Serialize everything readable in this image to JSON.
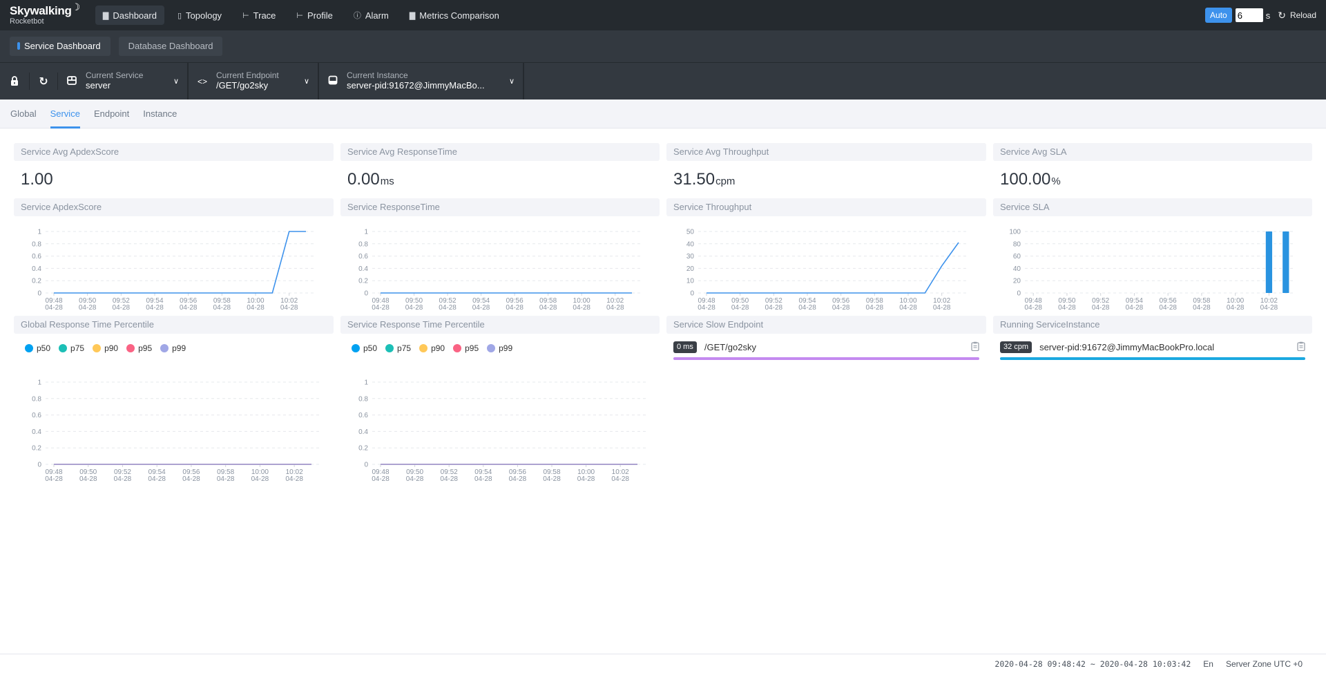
{
  "app": {
    "logo_main": "Skywalking",
    "logo_sub": "Rocketbot"
  },
  "nav": {
    "items": [
      {
        "label": "Dashboard",
        "icon": "chart-icon",
        "active": true
      },
      {
        "label": "Topology",
        "icon": "topology-icon",
        "active": false
      },
      {
        "label": "Trace",
        "icon": "trace-icon",
        "active": false
      },
      {
        "label": "Profile",
        "icon": "profile-icon",
        "active": false
      },
      {
        "label": "Alarm",
        "icon": "alarm-icon",
        "active": false
      },
      {
        "label": "Metrics Comparison",
        "icon": "chart-icon",
        "active": false
      }
    ],
    "auto_label": "Auto",
    "interval_value": "6",
    "interval_unit": "s",
    "reload_label": "Reload"
  },
  "dashboards": {
    "tabs": [
      {
        "label": "Service Dashboard",
        "active": true
      },
      {
        "label": "Database Dashboard",
        "active": false
      }
    ]
  },
  "selectors": {
    "service": {
      "label": "Current Service",
      "value": "server"
    },
    "endpoint": {
      "label": "Current Endpoint",
      "value": "/GET/go2sky"
    },
    "instance": {
      "label": "Current Instance",
      "value": "server-pid:91672@JimmyMacBo..."
    }
  },
  "view_tabs": [
    {
      "label": "Global",
      "active": false
    },
    {
      "label": "Service",
      "active": true
    },
    {
      "label": "Endpoint",
      "active": false
    },
    {
      "label": "Instance",
      "active": false
    }
  ],
  "cards": {
    "avg_apdex": {
      "title": "Service Avg ApdexScore",
      "value": "1.00",
      "unit": ""
    },
    "avg_resp": {
      "title": "Service Avg ResponseTime",
      "value": "0.00",
      "unit": "ms"
    },
    "avg_throughput": {
      "title": "Service Avg Throughput",
      "value": "31.50",
      "unit": "cpm"
    },
    "avg_sla": {
      "title": "Service Avg SLA",
      "value": "100.00",
      "unit": "%"
    },
    "apdex_chart_title": "Service ApdexScore",
    "resp_chart_title": "Service ResponseTime",
    "throughput_chart_title": "Service Throughput",
    "sla_chart_title": "Service SLA",
    "global_pct_title": "Global Response Time Percentile",
    "service_pct_title": "Service Response Time Percentile",
    "slow_endpoint": {
      "title": "Service Slow Endpoint",
      "items": [
        {
          "badge": "0 ms",
          "name": "/GET/go2sky",
          "bar_color": "#c48af0",
          "fill": 1.0
        }
      ]
    },
    "running_instance": {
      "title": "Running ServiceInstance",
      "items": [
        {
          "badge": "32 cpm",
          "name": "server-pid:91672@JimmyMacBookPro.local",
          "bar_color": "#1ba8e0",
          "fill": 1.0
        }
      ]
    }
  },
  "chart_data": [
    {
      "id": "apdex",
      "type": "line",
      "title": "Service ApdexScore",
      "x": [
        "09:48",
        "09:49",
        "09:50",
        "09:51",
        "09:52",
        "09:53",
        "09:54",
        "09:55",
        "09:56",
        "09:57",
        "09:58",
        "09:59",
        "10:00",
        "10:01",
        "10:02",
        "10:03"
      ],
      "xtick_labels": [
        [
          "09:48",
          "04-28"
        ],
        [
          "09:50",
          "04-28"
        ],
        [
          "09:52",
          "04-28"
        ],
        [
          "09:54",
          "04-28"
        ],
        [
          "09:56",
          "04-28"
        ],
        [
          "09:58",
          "04-28"
        ],
        [
          "10:00",
          "04-28"
        ],
        [
          "10:02",
          "04-28"
        ]
      ],
      "series": [
        {
          "name": "ApdexScore",
          "color": "#3d92ec",
          "values": [
            0,
            0,
            0,
            0,
            0,
            0,
            0,
            0,
            0,
            0,
            0,
            0,
            0,
            0,
            1,
            1
          ]
        }
      ],
      "ylim": [
        0,
        1
      ],
      "yticks": [
        "0",
        "0.2",
        "0.4",
        "0.6",
        "0.8",
        "1"
      ],
      "grid": true
    },
    {
      "id": "resp",
      "type": "line",
      "title": "Service ResponseTime",
      "x": [
        "09:48",
        "09:49",
        "09:50",
        "09:51",
        "09:52",
        "09:53",
        "09:54",
        "09:55",
        "09:56",
        "09:57",
        "09:58",
        "09:59",
        "10:00",
        "10:01",
        "10:02",
        "10:03"
      ],
      "xtick_labels": [
        [
          "09:48",
          "04-28"
        ],
        [
          "09:50",
          "04-28"
        ],
        [
          "09:52",
          "04-28"
        ],
        [
          "09:54",
          "04-28"
        ],
        [
          "09:56",
          "04-28"
        ],
        [
          "09:58",
          "04-28"
        ],
        [
          "10:00",
          "04-28"
        ],
        [
          "10:02",
          "04-28"
        ]
      ],
      "series": [
        {
          "name": "ResponseTime",
          "color": "#3d92ec",
          "values": [
            0,
            0,
            0,
            0,
            0,
            0,
            0,
            0,
            0,
            0,
            0,
            0,
            0,
            0,
            0,
            0
          ]
        }
      ],
      "ylim": [
        0,
        1
      ],
      "yticks": [
        "0",
        "0.2",
        "0.4",
        "0.6",
        "0.8",
        "1"
      ],
      "grid": true
    },
    {
      "id": "throughput",
      "type": "line",
      "title": "Service Throughput",
      "x": [
        "09:48",
        "09:49",
        "09:50",
        "09:51",
        "09:52",
        "09:53",
        "09:54",
        "09:55",
        "09:56",
        "09:57",
        "09:58",
        "09:59",
        "10:00",
        "10:01",
        "10:02",
        "10:03"
      ],
      "xtick_labels": [
        [
          "09:48",
          "04-28"
        ],
        [
          "09:50",
          "04-28"
        ],
        [
          "09:52",
          "04-28"
        ],
        [
          "09:54",
          "04-28"
        ],
        [
          "09:56",
          "04-28"
        ],
        [
          "09:58",
          "04-28"
        ],
        [
          "10:00",
          "04-28"
        ],
        [
          "10:02",
          "04-28"
        ]
      ],
      "series": [
        {
          "name": "Throughput",
          "color": "#3d92ec",
          "values": [
            0,
            0,
            0,
            0,
            0,
            0,
            0,
            0,
            0,
            0,
            0,
            0,
            0,
            0,
            22,
            41
          ]
        }
      ],
      "ylim": [
        0,
        50
      ],
      "yticks": [
        "0",
        "10",
        "20",
        "30",
        "40",
        "50"
      ],
      "grid": true
    },
    {
      "id": "sla",
      "type": "bar",
      "title": "Service SLA",
      "x": [
        "09:48",
        "09:49",
        "09:50",
        "09:51",
        "09:52",
        "09:53",
        "09:54",
        "09:55",
        "09:56",
        "09:57",
        "09:58",
        "09:59",
        "10:00",
        "10:01",
        "10:02",
        "10:03"
      ],
      "xtick_labels": [
        [
          "09:48",
          "04-28"
        ],
        [
          "09:50",
          "04-28"
        ],
        [
          "09:52",
          "04-28"
        ],
        [
          "09:54",
          "04-28"
        ],
        [
          "09:56",
          "04-28"
        ],
        [
          "09:58",
          "04-28"
        ],
        [
          "10:00",
          "04-28"
        ],
        [
          "10:02",
          "04-28"
        ]
      ],
      "series": [
        {
          "name": "SLA",
          "color": "#2993e0",
          "values": [
            0,
            0,
            0,
            0,
            0,
            0,
            0,
            0,
            0,
            0,
            0,
            0,
            0,
            0,
            100,
            100
          ]
        }
      ],
      "ylim": [
        0,
        100
      ],
      "yticks": [
        "0",
        "20",
        "40",
        "60",
        "80",
        "100"
      ],
      "grid": true
    },
    {
      "id": "global_pct",
      "type": "line",
      "title": "Global Response Time Percentile",
      "x": [
        "09:48",
        "09:49",
        "09:50",
        "09:51",
        "09:52",
        "09:53",
        "09:54",
        "09:55",
        "09:56",
        "09:57",
        "09:58",
        "09:59",
        "10:00",
        "10:01",
        "10:02",
        "10:03"
      ],
      "xtick_labels": [
        [
          "09:48",
          "04-28"
        ],
        [
          "09:50",
          "04-28"
        ],
        [
          "09:52",
          "04-28"
        ],
        [
          "09:54",
          "04-28"
        ],
        [
          "09:56",
          "04-28"
        ],
        [
          "09:58",
          "04-28"
        ],
        [
          "10:00",
          "04-28"
        ],
        [
          "10:02",
          "04-28"
        ]
      ],
      "legend": "top-left",
      "series": [
        {
          "name": "p50",
          "color": "#00a1f1",
          "values": [
            0,
            0,
            0,
            0,
            0,
            0,
            0,
            0,
            0,
            0,
            0,
            0,
            0,
            0,
            0,
            0
          ]
        },
        {
          "name": "p75",
          "color": "#1cbfb6",
          "values": [
            0,
            0,
            0,
            0,
            0,
            0,
            0,
            0,
            0,
            0,
            0,
            0,
            0,
            0,
            0,
            0
          ]
        },
        {
          "name": "p90",
          "color": "#ffc858",
          "values": [
            0,
            0,
            0,
            0,
            0,
            0,
            0,
            0,
            0,
            0,
            0,
            0,
            0,
            0,
            0,
            0
          ]
        },
        {
          "name": "p95",
          "color": "#fa6384",
          "values": [
            0,
            0,
            0,
            0,
            0,
            0,
            0,
            0,
            0,
            0,
            0,
            0,
            0,
            0,
            0,
            0
          ]
        },
        {
          "name": "p99",
          "color": "#a0a7e6",
          "values": [
            0,
            0,
            0,
            0,
            0,
            0,
            0,
            0,
            0,
            0,
            0,
            0,
            0,
            0,
            0,
            0
          ]
        }
      ],
      "ylim": [
        0,
        1
      ],
      "yticks": [
        "0",
        "0.2",
        "0.4",
        "0.6",
        "0.8",
        "1"
      ],
      "grid": true
    },
    {
      "id": "service_pct",
      "type": "line",
      "title": "Service Response Time Percentile",
      "x": [
        "09:48",
        "09:49",
        "09:50",
        "09:51",
        "09:52",
        "09:53",
        "09:54",
        "09:55",
        "09:56",
        "09:57",
        "09:58",
        "09:59",
        "10:00",
        "10:01",
        "10:02",
        "10:03"
      ],
      "xtick_labels": [
        [
          "09:48",
          "04-28"
        ],
        [
          "09:50",
          "04-28"
        ],
        [
          "09:52",
          "04-28"
        ],
        [
          "09:54",
          "04-28"
        ],
        [
          "09:56",
          "04-28"
        ],
        [
          "09:58",
          "04-28"
        ],
        [
          "10:00",
          "04-28"
        ],
        [
          "10:02",
          "04-28"
        ]
      ],
      "legend": "top-left",
      "series": [
        {
          "name": "p50",
          "color": "#00a1f1",
          "values": [
            0,
            0,
            0,
            0,
            0,
            0,
            0,
            0,
            0,
            0,
            0,
            0,
            0,
            0,
            0,
            0
          ]
        },
        {
          "name": "p75",
          "color": "#1cbfb6",
          "values": [
            0,
            0,
            0,
            0,
            0,
            0,
            0,
            0,
            0,
            0,
            0,
            0,
            0,
            0,
            0,
            0
          ]
        },
        {
          "name": "p90",
          "color": "#ffc858",
          "values": [
            0,
            0,
            0,
            0,
            0,
            0,
            0,
            0,
            0,
            0,
            0,
            0,
            0,
            0,
            0,
            0
          ]
        },
        {
          "name": "p95",
          "color": "#fa6384",
          "values": [
            0,
            0,
            0,
            0,
            0,
            0,
            0,
            0,
            0,
            0,
            0,
            0,
            0,
            0,
            0,
            0
          ]
        },
        {
          "name": "p99",
          "color": "#a0a7e6",
          "values": [
            0,
            0,
            0,
            0,
            0,
            0,
            0,
            0,
            0,
            0,
            0,
            0,
            0,
            0,
            0,
            0
          ]
        }
      ],
      "ylim": [
        0,
        1
      ],
      "yticks": [
        "0",
        "0.2",
        "0.4",
        "0.6",
        "0.8",
        "1"
      ],
      "grid": true
    }
  ],
  "footer": {
    "time_range": "2020-04-28 09:48:42 ~ 2020-04-28 10:03:42",
    "lang": "En",
    "zone": "Server Zone UTC +0"
  }
}
